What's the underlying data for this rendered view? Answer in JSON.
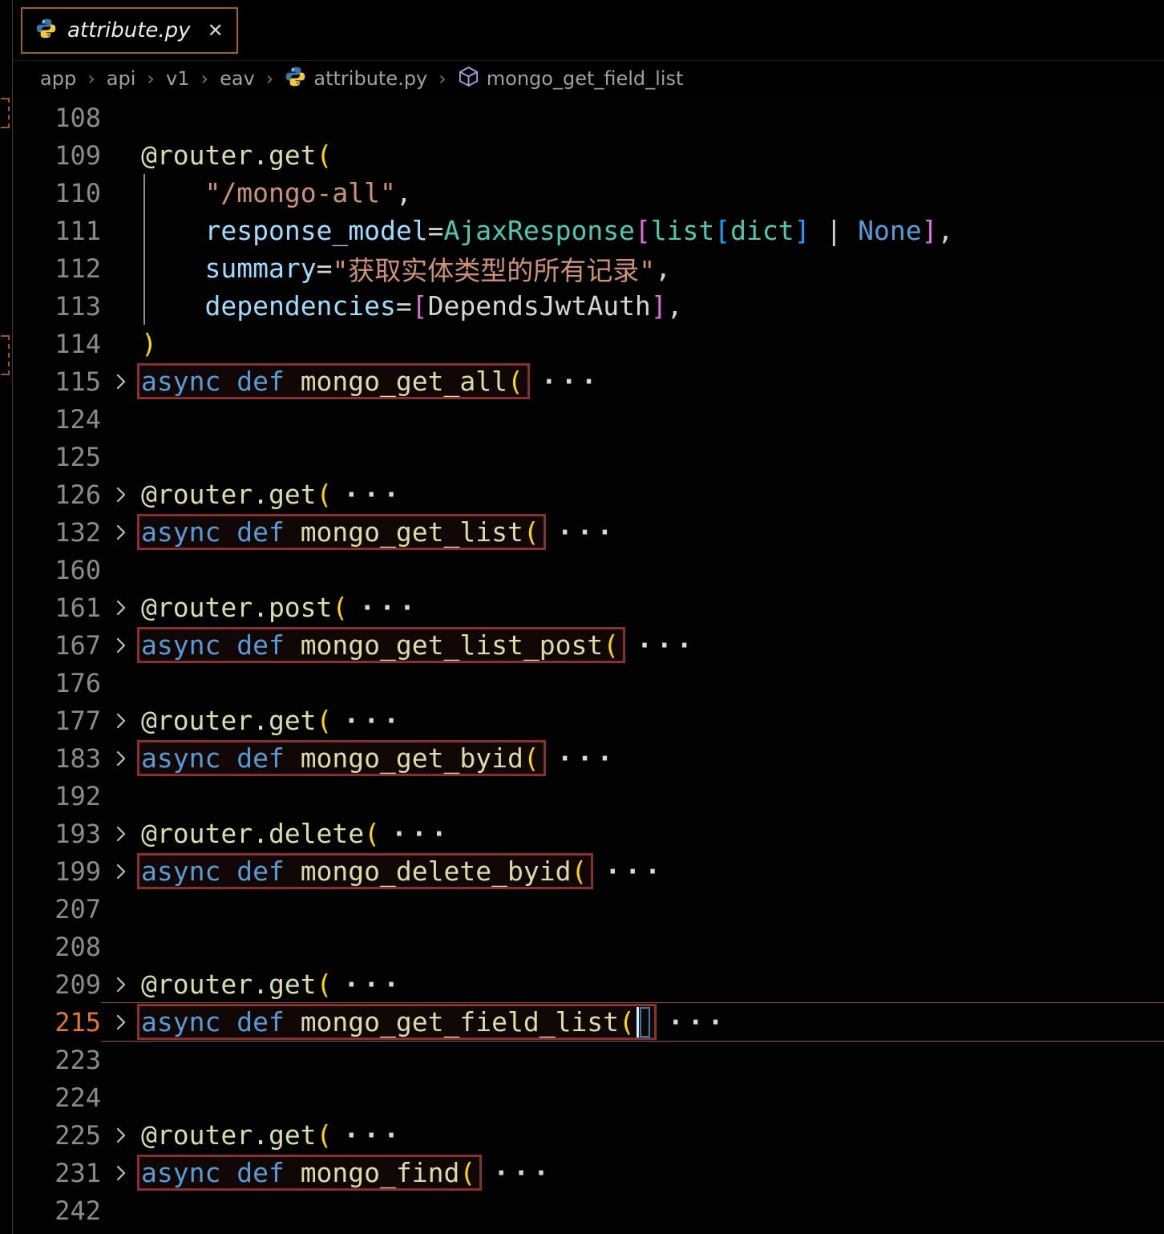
{
  "tab": {
    "title": "attribute.py",
    "close_glyph": "✕"
  },
  "breadcrumb": {
    "separator": "›",
    "items": [
      {
        "label": "app"
      },
      {
        "label": "api"
      },
      {
        "label": "v1"
      },
      {
        "label": "eav"
      },
      {
        "label": "attribute.py",
        "icon": "python-icon"
      },
      {
        "label": "mongo_get_field_list",
        "icon": "module-icon"
      }
    ]
  },
  "editor": {
    "fold_ellipsis": "···",
    "colors": {
      "deco": "#dcdcaa",
      "kw": "#569cd6",
      "fn": "#dcdcaa",
      "var": "#9cdcfe",
      "cls": "#4ec9b0",
      "str": "#ce9178",
      "pn": "#d4d4d4",
      "b1": "#ffd700",
      "b2": "#da70d6",
      "b3": "#179fff",
      "linenum": "#8b8b8b",
      "linenum_active": "#e0782e",
      "indent_guide": "#8f8f8f",
      "box_border": "#8a2f2f",
      "current_line_border": "#9a5520"
    },
    "lines": [
      {
        "num": "108",
        "tokens": []
      },
      {
        "num": "109",
        "tokens": [
          [
            "deco",
            "@router.get"
          ],
          [
            "b1",
            "("
          ]
        ]
      },
      {
        "num": "110",
        "guide": true,
        "tokens": [
          [
            "pn",
            "    "
          ],
          [
            "str",
            "\"/mongo-all\""
          ],
          [
            "pn",
            ","
          ]
        ]
      },
      {
        "num": "111",
        "guide": true,
        "tokens": [
          [
            "pn",
            "    "
          ],
          [
            "var",
            "response_model"
          ],
          [
            "pn",
            "="
          ],
          [
            "cls",
            "AjaxResponse"
          ],
          [
            "b2",
            "["
          ],
          [
            "cls",
            "list"
          ],
          [
            "b3",
            "["
          ],
          [
            "cls",
            "dict"
          ],
          [
            "b3",
            "]"
          ],
          [
            "pn",
            " | "
          ],
          [
            "kw",
            "None"
          ],
          [
            "b2",
            "]"
          ],
          [
            "pn",
            ","
          ]
        ]
      },
      {
        "num": "112",
        "guide": true,
        "tokens": [
          [
            "pn",
            "    "
          ],
          [
            "var",
            "summary"
          ],
          [
            "pn",
            "="
          ],
          [
            "str",
            "\"获取实体类型的所有记录\""
          ],
          [
            "pn",
            ","
          ]
        ]
      },
      {
        "num": "113",
        "guide": true,
        "tokens": [
          [
            "pn",
            "    "
          ],
          [
            "var",
            "dependencies"
          ],
          [
            "pn",
            "="
          ],
          [
            "b2",
            "["
          ],
          [
            "pn",
            "DependsJwtAuth"
          ],
          [
            "b2",
            "]"
          ],
          [
            "pn",
            ","
          ]
        ]
      },
      {
        "num": "114",
        "tokens": [
          [
            "b1",
            ")"
          ]
        ]
      },
      {
        "num": "115",
        "fold": true,
        "box": true,
        "ellipsis": true,
        "tokens": [
          [
            "kw",
            "async def "
          ],
          [
            "fn",
            "mongo_get_all"
          ],
          [
            "b1",
            "("
          ]
        ]
      },
      {
        "num": "124",
        "tokens": []
      },
      {
        "num": "125",
        "tokens": []
      },
      {
        "num": "126",
        "fold": true,
        "ellipsis": true,
        "tokens": [
          [
            "deco",
            "@router.get"
          ],
          [
            "b1",
            "("
          ]
        ]
      },
      {
        "num": "132",
        "fold": true,
        "box": true,
        "ellipsis": true,
        "tokens": [
          [
            "kw",
            "async def "
          ],
          [
            "fn",
            "mongo_get_list"
          ],
          [
            "b1",
            "("
          ]
        ]
      },
      {
        "num": "160",
        "tokens": []
      },
      {
        "num": "161",
        "fold": true,
        "ellipsis": true,
        "tokens": [
          [
            "deco",
            "@router.post"
          ],
          [
            "b1",
            "("
          ]
        ]
      },
      {
        "num": "167",
        "fold": true,
        "box": true,
        "ellipsis": true,
        "tokens": [
          [
            "kw",
            "async def "
          ],
          [
            "fn",
            "mongo_get_list_post"
          ],
          [
            "b1",
            "("
          ]
        ]
      },
      {
        "num": "176",
        "tokens": []
      },
      {
        "num": "177",
        "fold": true,
        "ellipsis": true,
        "tokens": [
          [
            "deco",
            "@router.get"
          ],
          [
            "b1",
            "("
          ]
        ]
      },
      {
        "num": "183",
        "fold": true,
        "box": true,
        "ellipsis": true,
        "tokens": [
          [
            "kw",
            "async def "
          ],
          [
            "fn",
            "mongo_get_byid"
          ],
          [
            "b1",
            "("
          ]
        ]
      },
      {
        "num": "192",
        "tokens": []
      },
      {
        "num": "193",
        "fold": true,
        "ellipsis": true,
        "tokens": [
          [
            "deco",
            "@router.delete"
          ],
          [
            "b1",
            "("
          ]
        ]
      },
      {
        "num": "199",
        "fold": true,
        "box": true,
        "ellipsis": true,
        "tokens": [
          [
            "kw",
            "async def "
          ],
          [
            "fn",
            "mongo_delete_byid"
          ],
          [
            "b1",
            "("
          ]
        ]
      },
      {
        "num": "207",
        "tokens": []
      },
      {
        "num": "208",
        "tokens": []
      },
      {
        "num": "209",
        "fold": true,
        "ellipsis": true,
        "tokens": [
          [
            "deco",
            "@router.get"
          ],
          [
            "b1",
            "("
          ]
        ]
      },
      {
        "num": "215",
        "fold": true,
        "box": true,
        "ellipsis": true,
        "current": true,
        "cursor": true,
        "tokens": [
          [
            "kw",
            "async def "
          ],
          [
            "fn",
            "mongo_get_field_list"
          ],
          [
            "b1",
            "("
          ]
        ]
      },
      {
        "num": "223",
        "tokens": []
      },
      {
        "num": "224",
        "tokens": []
      },
      {
        "num": "225",
        "fold": true,
        "ellipsis": true,
        "tokens": [
          [
            "deco",
            "@router.get"
          ],
          [
            "b1",
            "("
          ]
        ]
      },
      {
        "num": "231",
        "fold": true,
        "box": true,
        "ellipsis": true,
        "tokens": [
          [
            "kw",
            "async def "
          ],
          [
            "fn",
            "mongo_find"
          ],
          [
            "b1",
            "("
          ]
        ]
      },
      {
        "num": "242",
        "tokens": []
      }
    ]
  }
}
